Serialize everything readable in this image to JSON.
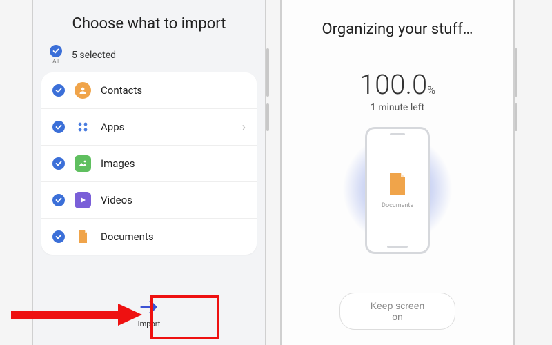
{
  "left": {
    "title": "Choose what to import",
    "all_label": "All",
    "selected_text": "5 selected",
    "items": [
      {
        "label": "Contacts"
      },
      {
        "label": "Apps"
      },
      {
        "label": "Images"
      },
      {
        "label": "Videos"
      },
      {
        "label": "Documents"
      }
    ],
    "import_label": "Import"
  },
  "right": {
    "title": "Organizing your stuff…",
    "percent": "100.0",
    "percent_unit": "%",
    "eta": "1 minute left",
    "current_item": "Documents",
    "keep_screen_label": "Keep screen on"
  },
  "colors": {
    "accent": "#3b6fd8",
    "highlight": "#e11"
  }
}
